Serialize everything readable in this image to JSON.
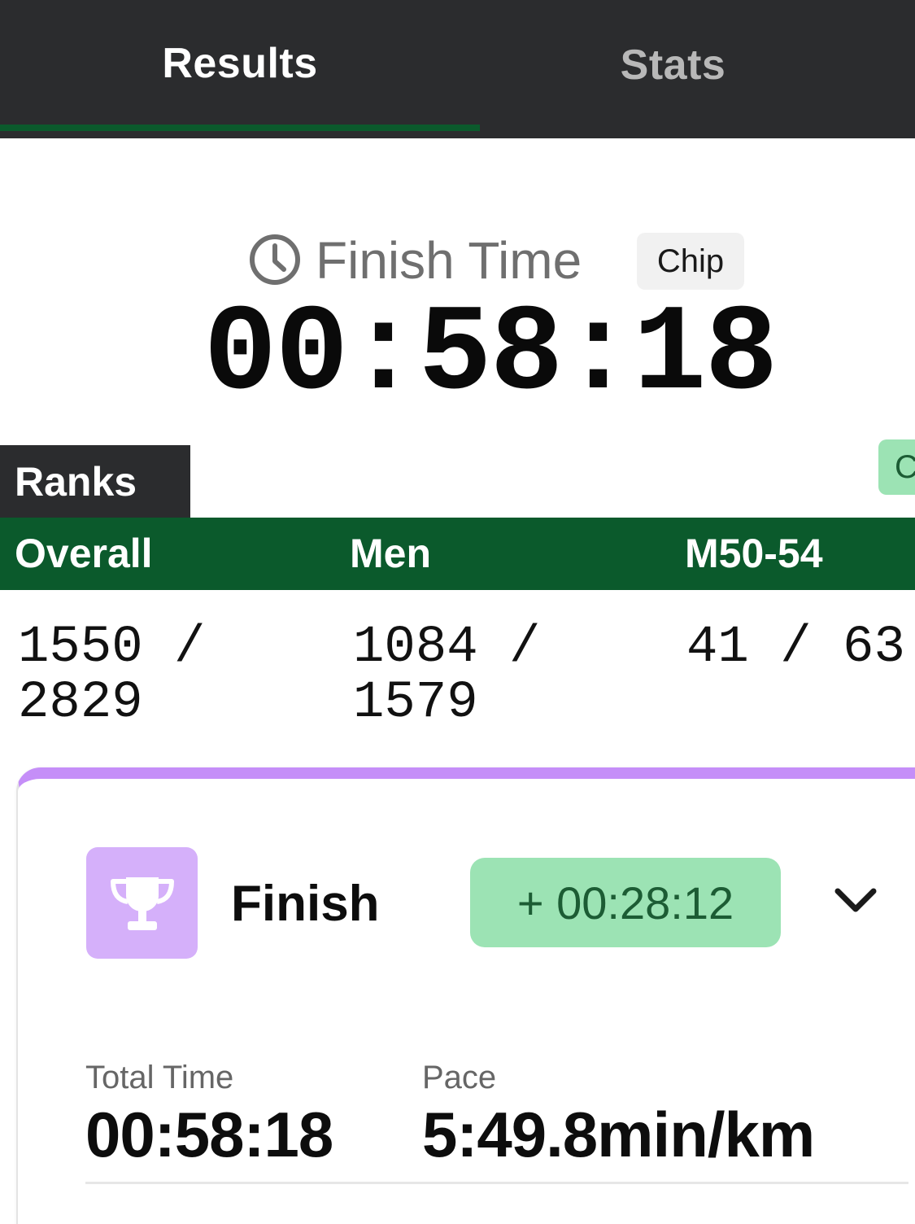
{
  "tabs": {
    "results": "Results",
    "stats": "Stats"
  },
  "finish": {
    "label": "Finish Time",
    "timing_type": "Chip",
    "time": "00:58:18"
  },
  "ranks": {
    "title": "Ranks",
    "edge_pill_text": "C",
    "columns": [
      {
        "label": "Overall",
        "value": "1550 / 2829"
      },
      {
        "label": "Men",
        "value": "1084 / 1579"
      },
      {
        "label": "M50-54",
        "value": "41 / 63"
      }
    ]
  },
  "split": {
    "name": "Finish",
    "icon": "trophy-icon",
    "delta": "+ 00:28:12",
    "total_time_label": "Total Time",
    "total_time": "00:58:18",
    "pace_label": "Pace",
    "pace": "5:49.8min/km"
  },
  "colors": {
    "tabbar": "#2b2c2e",
    "accent_green": "#0b5a2c",
    "pill_green": "#9ce3b4",
    "card_purple": "#c58ef8",
    "trophy_bg": "#d5b0fa"
  }
}
